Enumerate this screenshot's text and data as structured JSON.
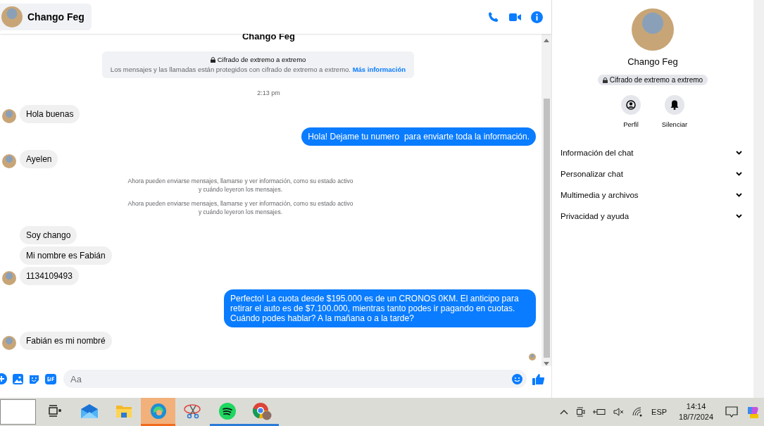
{
  "header": {
    "contact_name": "Chango Feg"
  },
  "chat": {
    "contact_name": "Chango Feg",
    "encryption": {
      "title": "Cifrado de extremo a extremo",
      "text": "Los mensajes y las llamadas están protegidos con cifrado de extremo a extremo.",
      "link": "Más información"
    },
    "messages": [
      {
        "kind": "time",
        "text": "2:13 pm"
      },
      {
        "kind": "incoming",
        "text": "Hola buenas",
        "avatar": true
      },
      {
        "kind": "outgoing",
        "text": "Hola! Dejame tu numero  para enviarte toda la información."
      },
      {
        "kind": "incoming",
        "text": "Ayelen",
        "avatar": true
      },
      {
        "kind": "system",
        "text": "Ahora pueden enviarse mensajes, llamarse y ver información, como su estado activo y cuándo leyeron los mensajes."
      },
      {
        "kind": "system",
        "text": "Ahora pueden enviarse mensajes, llamarse y ver información, como su estado activo y cuándo leyeron los mensajes."
      },
      {
        "kind": "incoming",
        "text": "Soy chango",
        "avatar": false
      },
      {
        "kind": "incoming",
        "text": "Mi nombre es Fabián",
        "avatar": false
      },
      {
        "kind": "incoming",
        "text": "1134109493",
        "avatar": true
      },
      {
        "kind": "outgoing",
        "text": "Perfecto! La cuota desde $195.000 es de un CRONOS 0KM. El anticipo para retirar el auto es de $7.100.000, mientras tanto podes ir pagando en cuotas. Cuándo podes hablar? A la mañana o a la tarde?"
      },
      {
        "kind": "incoming",
        "text": "Fabián es mi nombré",
        "avatar": true
      }
    ]
  },
  "composer": {
    "placeholder": "Aa"
  },
  "profile": {
    "name": "Chango Feg",
    "badge": "Cifrado de extremo a extremo",
    "actions": [
      {
        "kind": "profile",
        "label": "Perfil"
      },
      {
        "kind": "mute",
        "label": "Silenciar"
      }
    ],
    "sections": [
      {
        "label": "Información del chat",
        "expanded": false
      },
      {
        "label": "Personalizar chat",
        "expanded": false
      },
      {
        "label": "Multimedia y archivos",
        "expanded": false
      },
      {
        "label": "Privacidad y ayuda",
        "expanded": false
      }
    ]
  },
  "taskbar": {
    "apps": [
      {
        "kind": "task-view",
        "active": false,
        "running": false
      },
      {
        "kind": "mail",
        "active": false,
        "running": false
      },
      {
        "kind": "files",
        "active": false,
        "running": false
      },
      {
        "kind": "edge",
        "active": true,
        "running": true
      },
      {
        "kind": "snip",
        "active": false,
        "running": false
      },
      {
        "kind": "spotify",
        "active": false,
        "running": true
      },
      {
        "kind": "chrome",
        "active": false,
        "running": true
      }
    ],
    "tray": {
      "language": "ESP",
      "time": "14:14",
      "date": "18/7/2024"
    }
  }
}
